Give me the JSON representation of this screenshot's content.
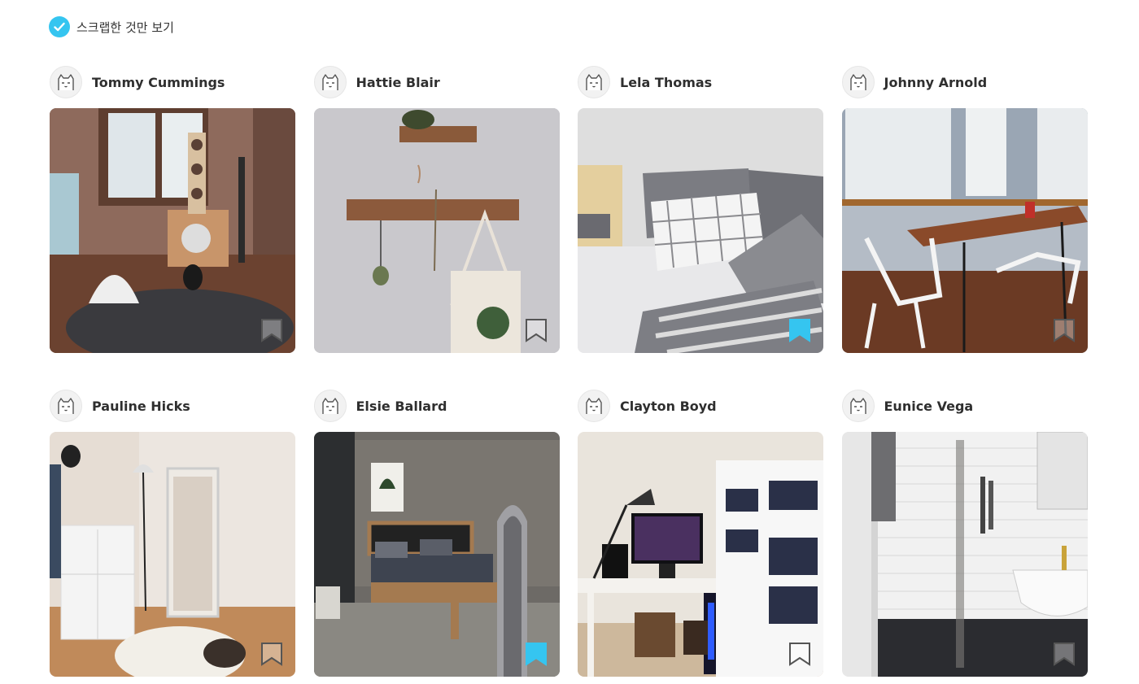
{
  "filter": {
    "label": "스크랩한 것만 보기",
    "checked": true,
    "check_color": "#35c5f0"
  },
  "bookmark_colors": {
    "active": "#35c5f0",
    "inactive_fill": "rgba(255,255,255,0.35)",
    "inactive_stroke": "#555555"
  },
  "cards": [
    {
      "user": "Tommy Cummings",
      "scene": "living-room-cat-tower",
      "bookmarked": false
    },
    {
      "user": "Hattie Blair",
      "scene": "wall-hooks-tote-bag",
      "bookmarked": false
    },
    {
      "user": "Lela Thomas",
      "scene": "bed-striped-pillows",
      "bookmarked": true
    },
    {
      "user": "Johnny Arnold",
      "scene": "dining-table-folding-chairs",
      "bookmarked": false
    },
    {
      "user": "Pauline Hicks",
      "scene": "bedroom-mirror-cat-rug",
      "bookmarked": false
    },
    {
      "user": "Elsie Ballard",
      "scene": "bedroom-wooden-bed",
      "bookmarked": true
    },
    {
      "user": "Clayton Boyd",
      "scene": "desk-setup-bookshelf",
      "bookmarked": false
    },
    {
      "user": "Eunice Vega",
      "scene": "bathroom-shower-tiles",
      "bookmarked": false
    }
  ]
}
